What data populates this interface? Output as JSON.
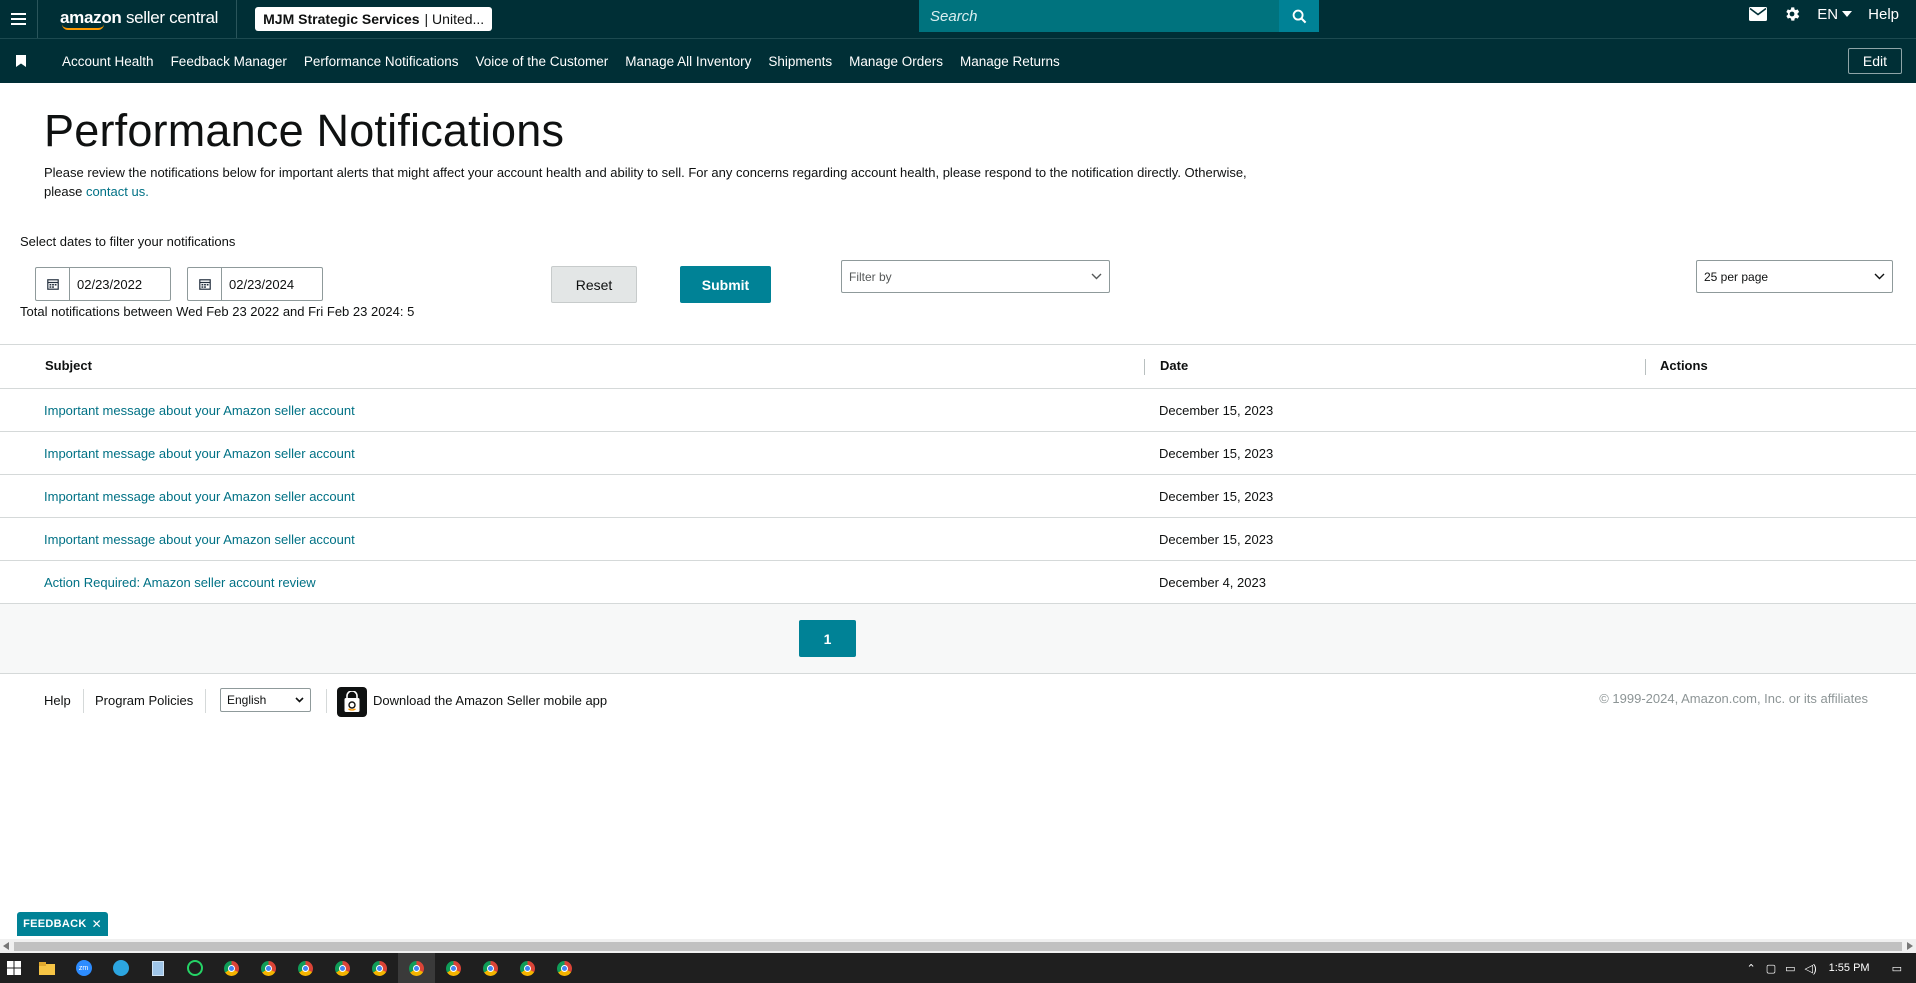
{
  "header": {
    "logo_brand": "amazon",
    "logo_product": "seller central",
    "account_name": "MJM Strategic Services",
    "account_region": "| United...",
    "search_placeholder": "Search",
    "language": "EN",
    "help": "Help"
  },
  "nav": {
    "items": [
      "Account Health",
      "Feedback Manager",
      "Performance Notifications",
      "Voice of the Customer",
      "Manage All Inventory",
      "Shipments",
      "Manage Orders",
      "Manage Returns"
    ],
    "edit": "Edit"
  },
  "page": {
    "title": "Performance Notifications",
    "intro": "Please review the notifications below for important alerts that might affect your account health and ability to sell. For any concerns regarding account health, please respond to the notification directly. Otherwise, please",
    "contact_link": "contact us.",
    "filter_label": "Select dates to filter your notifications",
    "start_date": "02/23/2022",
    "end_date": "02/23/2024",
    "reset": "Reset",
    "submit": "Submit",
    "filter_by": "Filter by",
    "per_page": "25 per page",
    "total": "Total notifications between Wed Feb 23 2022 and Fri Feb 23 2024: 5"
  },
  "table": {
    "columns": [
      "Subject",
      "Date",
      "Actions"
    ],
    "rows": [
      {
        "subject": "Important message about your Amazon seller account",
        "date": "December 15, 2023"
      },
      {
        "subject": "Important message about your Amazon seller account",
        "date": "December 15, 2023"
      },
      {
        "subject": "Important message about your Amazon seller account",
        "date": "December 15, 2023"
      },
      {
        "subject": "Important message about your Amazon seller account",
        "date": "December 15, 2023"
      },
      {
        "subject": "Action Required: Amazon seller account review",
        "date": "December 4, 2023"
      }
    ]
  },
  "pagination": {
    "current": "1"
  },
  "footer": {
    "help": "Help",
    "policies": "Program Policies",
    "language": "English",
    "app_text": "Download the Amazon Seller mobile app",
    "copyright": "© 1999-2024, Amazon.com, Inc. or its affiliates"
  },
  "feedback": "FEEDBACK",
  "taskbar": {
    "time": "1:55 PM"
  },
  "colors": {
    "header_bg": "#002f36",
    "accent": "#008296",
    "link": "#007185"
  }
}
